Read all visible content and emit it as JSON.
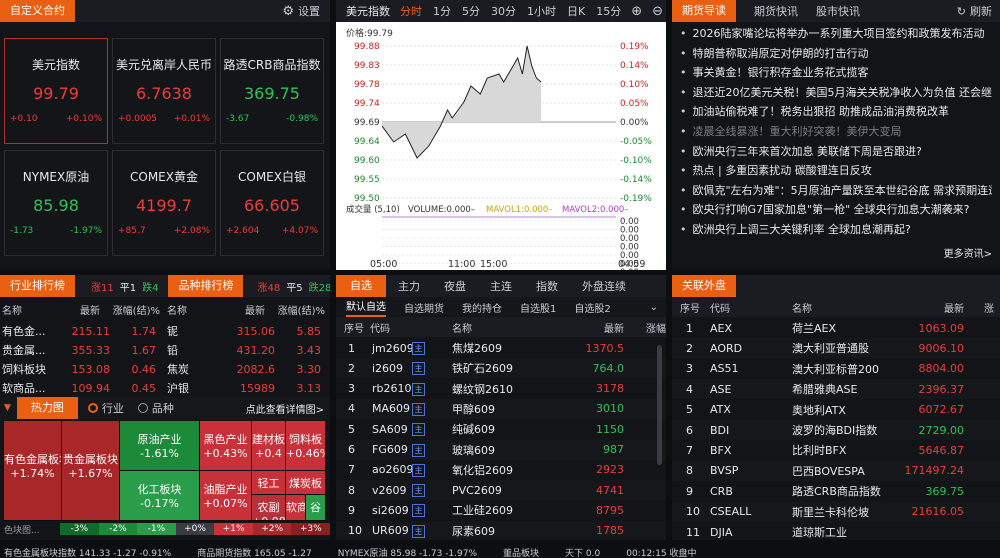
{
  "watchlist": {
    "title": "自定义合约",
    "settings_label": "设置",
    "tiles": [
      {
        "name": "美元指数",
        "value": "99.79",
        "change": "+0.10",
        "pct": "+0.10%",
        "color": "red"
      },
      {
        "name": "美元兑离岸人民币",
        "value": "6.7638",
        "change": "+0.0005",
        "pct": "+0.01%",
        "color": "red"
      },
      {
        "name": "路透CRB商品指数",
        "value": "369.75",
        "change": "-3.67",
        "pct": "-0.98%",
        "color": "green"
      },
      {
        "name": "NYMEX原油",
        "value": "85.98",
        "change": "-1.73",
        "pct": "-1.97%",
        "color": "green"
      },
      {
        "name": "COMEX黄金",
        "value": "4199.7",
        "change": "+85.7",
        "pct": "+2.08%",
        "color": "red"
      },
      {
        "name": "COMEX白银",
        "value": "66.605",
        "change": "+2.604",
        "pct": "+4.07%",
        "color": "red"
      }
    ]
  },
  "chart": {
    "symbol": "美元指数",
    "periods": [
      "分时",
      "1分",
      "5分",
      "30分",
      "1小时",
      "日K",
      "15分"
    ],
    "active_period": "分时",
    "price_label": "价格:99.79",
    "y_left": [
      "99.88",
      "99.83",
      "99.78",
      "99.74",
      "99.69",
      "99.64",
      "99.60",
      "99.55",
      "99.50"
    ],
    "y_right": [
      "0.19%",
      "0.14%",
      "0.10%",
      "0.05%",
      "0.00%",
      "-0.05%",
      "-0.10%",
      "-0.14%",
      "-0.19%"
    ],
    "vol_legend": {
      "vol": "成交量 (5,10)",
      "volume": "VOLUME:0.000–",
      "mavol1": "MAVOL1:0.000–",
      "mavol2": "MAVOL2:0.000–"
    },
    "vol_y": [
      "0.00",
      "0.00",
      "0.00",
      "0.00",
      "0.00",
      "0.00",
      "0.00"
    ],
    "time_labels": [
      "05:00",
      "11:00",
      "15:00",
      "04:59"
    ]
  },
  "news": {
    "tabs": [
      "期货导读",
      "期货快讯",
      "股市快讯"
    ],
    "active_tab": "期货导读",
    "refresh_label": "刷新",
    "more_label": "更多资讯>",
    "items": [
      "2026陆家嘴论坛将举办一系列重大项目签约和政策发布活动",
      "特朗普称取消原定对伊朗的打击行动",
      "事关黄金！银行积存金业务花式揽客",
      "退还近20亿美元关税！美国5月海关关税净收入为负值 还会继",
      "加油站偷税难了！税务出狠招 助推成品油消费税改革",
      "凌晨全线暴涨！重大利好突袭！美伊大变局",
      "欧洲央行三年来首次加息 美联储下周是否跟进?",
      "热点 | 多重因素扰动 碳酸锂连日反攻",
      "欧佩克\"左右为难\"：5月原油产量跌至本世纪谷底 需求预期连遭",
      "欧央行打响G7国家加息\"第一枪\" 全球央行加息大潮袭来?",
      "欧洲央行上调三大关键利率 全球加息潮再起?"
    ]
  },
  "industry": {
    "tab1": "行业排行榜",
    "stats1": [
      {
        "label": "涨11",
        "color": "red"
      },
      {
        "label": "平1",
        "color": "white"
      },
      {
        "label": "跌4",
        "color": "green"
      }
    ],
    "tab2": "品种排行榜",
    "stats2": [
      {
        "label": "涨48",
        "color": "red"
      },
      {
        "label": "平5",
        "color": "white"
      },
      {
        "label": "跌28",
        "color": "green"
      }
    ],
    "headers": [
      "名称",
      "最新",
      "涨幅(结)%"
    ],
    "left_rows": [
      [
        "有色金...",
        "215.11",
        "1.74",
        "red"
      ],
      [
        "贵金属...",
        "355.33",
        "1.67",
        "red"
      ],
      [
        "饲料板块",
        "153.08",
        "0.46",
        "red"
      ],
      [
        "软商品...",
        "109.94",
        "0.45",
        "red"
      ]
    ],
    "right_rows": [
      [
        "铌",
        "315.06",
        "5.85",
        "red"
      ],
      [
        "铅",
        "431.20",
        "3.43",
        "red"
      ],
      [
        "焦炭",
        "2082.6",
        "3.30",
        "red"
      ],
      [
        "沪银",
        "15989",
        "3.13",
        "red"
      ]
    ],
    "heatmap_tab": "热力图",
    "radio_industry": "行业",
    "radio_variety": "品种",
    "detail_link": "点此查看详情图>",
    "heat_cells": [
      {
        "name": "有色金属板块",
        "pct": "+1.74%",
        "color": "#a8282a"
      },
      {
        "name": "贵金属板块",
        "pct": "+1.67%",
        "color": "#a8282a"
      },
      {
        "name": "原油产业",
        "pct": "-1.61%",
        "color": "#1d8a3a"
      },
      {
        "name": "黑色产业",
        "pct": "+0.43%",
        "color": "#c9313a"
      },
      {
        "name": "建材板",
        "pct": "+0.4",
        "color": "#c9313a"
      },
      {
        "name": "饲料板",
        "pct": "+0.46%",
        "color": "#c9313a"
      },
      {
        "name": "化工板块",
        "pct": "-0.17%",
        "color": "#2a9d4a"
      },
      {
        "name": "油脂产业",
        "pct": "+0.07%",
        "color": "#c9313a"
      },
      {
        "name": "轻工",
        "pct": "",
        "color": "#c9313a"
      },
      {
        "name": "煤炭板",
        "pct": "",
        "color": "#c9313a"
      },
      {
        "name": "农副",
        "pct": "+0.08",
        "color": "#b8303a"
      },
      {
        "name": "软商",
        "pct": "",
        "color": "#c9313a"
      },
      {
        "name": "谷",
        "pct": "",
        "color": "#2a9d4a"
      }
    ],
    "legend_label": "色块图...",
    "legend": [
      {
        "label": "-3%",
        "color": "#0f6b2a"
      },
      {
        "label": "-2%",
        "color": "#1d8a3a"
      },
      {
        "label": "-1%",
        "color": "#2a9d4a"
      },
      {
        "label": "+0%",
        "color": "#3a3c44"
      },
      {
        "label": "+1%",
        "color": "#c9313a"
      },
      {
        "label": "+2%",
        "color": "#a8282a"
      },
      {
        "label": "+3%",
        "color": "#8a1e20"
      }
    ]
  },
  "quotes": {
    "tabs": [
      "自选",
      "主力",
      "夜盘",
      "主连",
      "指数",
      "外盘连续"
    ],
    "active_tab": "自选",
    "subtabs": [
      "默认自选",
      "自选期货",
      "我的持仓",
      "自选股1",
      "自选股2"
    ],
    "active_subtab": "默认自选",
    "headers": [
      "序号",
      "代码",
      "名称",
      "最新",
      "涨幅"
    ],
    "rows": [
      [
        "1",
        "jm2609",
        "焦煤2609",
        "1370.5",
        "red"
      ],
      [
        "2",
        "i2609",
        "铁矿石2609",
        "764.0",
        "green"
      ],
      [
        "3",
        "rb2610",
        "螺纹钢2610",
        "3178",
        "red"
      ],
      [
        "4",
        "MA609",
        "甲醇609",
        "3010",
        "green"
      ],
      [
        "5",
        "SA609",
        "纯碱609",
        "1150",
        "green"
      ],
      [
        "6",
        "FG609",
        "玻璃609",
        "987",
        "green"
      ],
      [
        "7",
        "ao2609",
        "氧化铝2609",
        "2923",
        "red"
      ],
      [
        "8",
        "v2609",
        "PVC2609",
        "4741",
        "red"
      ],
      [
        "9",
        "si2609",
        "工业硅2609",
        "8795",
        "red"
      ],
      [
        "10",
        "UR609",
        "尿素609",
        "1785",
        "red"
      ]
    ]
  },
  "related": {
    "title": "关联外盘",
    "headers": [
      "序号",
      "代码",
      "名称",
      "最新",
      "涨"
    ],
    "rows": [
      [
        "1",
        "AEX",
        "荷兰AEX",
        "1063.09",
        "red"
      ],
      [
        "2",
        "AORD",
        "澳大利亚普通股",
        "9006.10",
        "red"
      ],
      [
        "3",
        "AS51",
        "澳大利亚标普200",
        "8804.00",
        "red"
      ],
      [
        "4",
        "ASE",
        "希腊雅典ASE",
        "2396.37",
        "red"
      ],
      [
        "5",
        "ATX",
        "奥地利ATX",
        "6072.67",
        "red"
      ],
      [
        "6",
        "BDI",
        "波罗的海BDI指数",
        "2729.00",
        "green"
      ],
      [
        "7",
        "BFX",
        "比利时BFX",
        "5646.87",
        "red"
      ],
      [
        "8",
        "BVSP",
        "巴西BOVESPA",
        "171497.24",
        "red"
      ],
      [
        "9",
        "CRB",
        "路透CRB商品指数",
        "369.75",
        "green"
      ],
      [
        "10",
        "CSEALL",
        "斯里兰卡科伦坡",
        "21616.05",
        "red"
      ],
      [
        "11",
        "DJIA",
        "道琼斯工业",
        "",
        "red"
      ]
    ]
  },
  "ticker": {
    "items": [
      "有色金属板块指数  141.33  -1.27  -0.91%",
      "商品期货指数  165.05  -1.27",
      "NYMEX原油  85.98  -1.73  -1.97%",
      "董品板块",
      "天下  0.0",
      "00:12:15 收盘中"
    ]
  }
}
